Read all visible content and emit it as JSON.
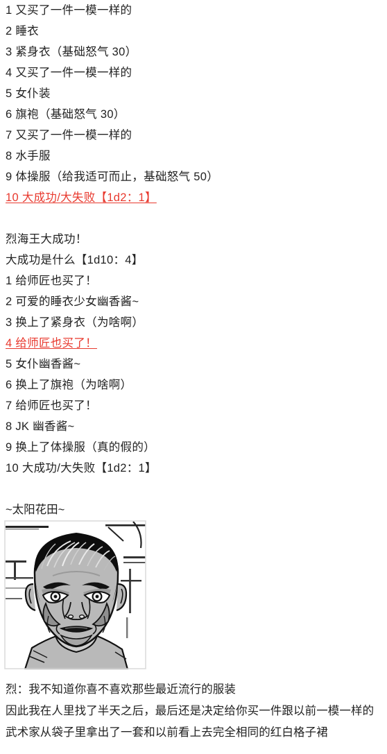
{
  "section_one": {
    "lines": [
      {
        "text": "1  又买了一件一模一样的",
        "color": "default"
      },
      {
        "text": "2  睡衣",
        "color": "default"
      },
      {
        "text": "3  紧身衣（基础怒气 30）",
        "color": "default"
      },
      {
        "text": "4  又买了一件一模一样的",
        "color": "default"
      },
      {
        "text": "5  女仆装",
        "color": "default"
      },
      {
        "text": "6  旗袍（基础怒气 30）",
        "color": "default"
      },
      {
        "text": "7  又买了一件一模一样的",
        "color": "default"
      },
      {
        "text": "8  水手服",
        "color": "default"
      },
      {
        "text": "9  体操服（给我适可而止，基础怒气 50）",
        "color": "default"
      },
      {
        "text": "10  大成功/大失败【1d2：1】",
        "color": "red"
      }
    ]
  },
  "section_two": {
    "heading_one": "烈海王大成功！",
    "heading_two": "大成功是什么【1d10：4】",
    "lines": [
      {
        "text": "1  给师匠也买了！",
        "color": "default"
      },
      {
        "text": "2  可爱的睡衣少女幽香酱~",
        "color": "default"
      },
      {
        "text": "3  换上了紧身衣（为啥啊）",
        "color": "default"
      },
      {
        "text": "4  给师匠也买了！",
        "color": "red"
      },
      {
        "text": "5  女仆幽香酱~",
        "color": "default"
      },
      {
        "text": "6  换上了旗袍（为啥啊）",
        "color": "default"
      },
      {
        "text": "7  给师匠也买了！",
        "color": "default"
      },
      {
        "text": "8 JK 幽香酱~",
        "color": "default"
      },
      {
        "text": "9  换上了体操服（真的假的）",
        "color": "default"
      },
      {
        "text": "10  大成功/大失败【1d2：1】",
        "color": "default"
      }
    ]
  },
  "image_section": {
    "caption": "~太阳花田~",
    "image_alt": "manga-panel-retsu-kaioh-face"
  },
  "footer": {
    "lines": [
      "烈：我不知道你喜不喜欢那些最近流行的服装",
      "因此我在人里找了半天之后，最后还是决定给你买一件跟以前一模一样的",
      "武术家从袋子里拿出了一套和以前看上去完全相同的红白格子裙"
    ]
  },
  "colors": {
    "red": "#e8392e",
    "text": "#222222",
    "background": "#ffffff"
  }
}
